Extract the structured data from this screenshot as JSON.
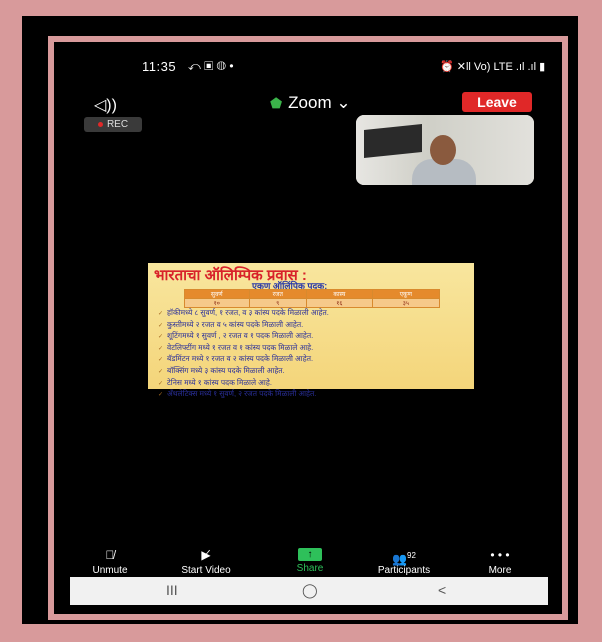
{
  "status_bar": {
    "time": "11:35",
    "left_icons": "⤺ ▣ ◍ •",
    "right_icons": "⏰ ✕ll Vo) LTE .ıl .ıl ▮"
  },
  "header": {
    "app_title": "Zoom ⌄",
    "leave_label": "Leave",
    "rec_label": "REC"
  },
  "slide": {
    "title": "भारताचा ऑलिम्पिक प्रवास :",
    "subtitle": "एकूण ऑलिंपिक पदक:",
    "table_headers": [
      "सुवर्ण",
      "रजत",
      "कास्य",
      "एकूण"
    ],
    "table_values": [
      "१०",
      "९",
      "१६",
      "३५"
    ],
    "bullets": [
      "हॉकीमध्ये ८ सुवर्ण, १ रजत, व ३ कांस्य पदके मिळाली आहेत.",
      "कुस्तीमध्ये २ रजत व ५ कांस्य पदके मिळाली आहेत.",
      "शूटिंगमध्ये १ सुवर्ण , २ रजत व १ पदक मिळाली आहेत.",
      "वेटलिफ्टींग मध्ये १ रजत व १ कांस्य पदक मिळाले आहे.",
      "बॅडमिंटन मध्ये १ रजत व २ कांस्य पदके मिळाली आहेत.",
      "बॉक्सिंग मध्ये ३ कांस्य पदके मिळाली आहेत.",
      "टेनिस मध्ये १ कांस्य पदक मिळाले आहे.",
      "अँथलेटिक्स मध्ये १ सुवर्ण, २ रजत पदके मिळाली आहेत."
    ]
  },
  "toolbar": {
    "unmute": "Unmute",
    "start_video": "Start Video",
    "share": "Share",
    "participants": "Participants",
    "participants_count": "92",
    "more": "More"
  },
  "nav_bar": {
    "recents": "III",
    "home": "◯",
    "back": "<"
  },
  "colors": {
    "leave": "#e02828",
    "share_green": "#2ec05a",
    "frame_pink": "#d89a9b"
  }
}
